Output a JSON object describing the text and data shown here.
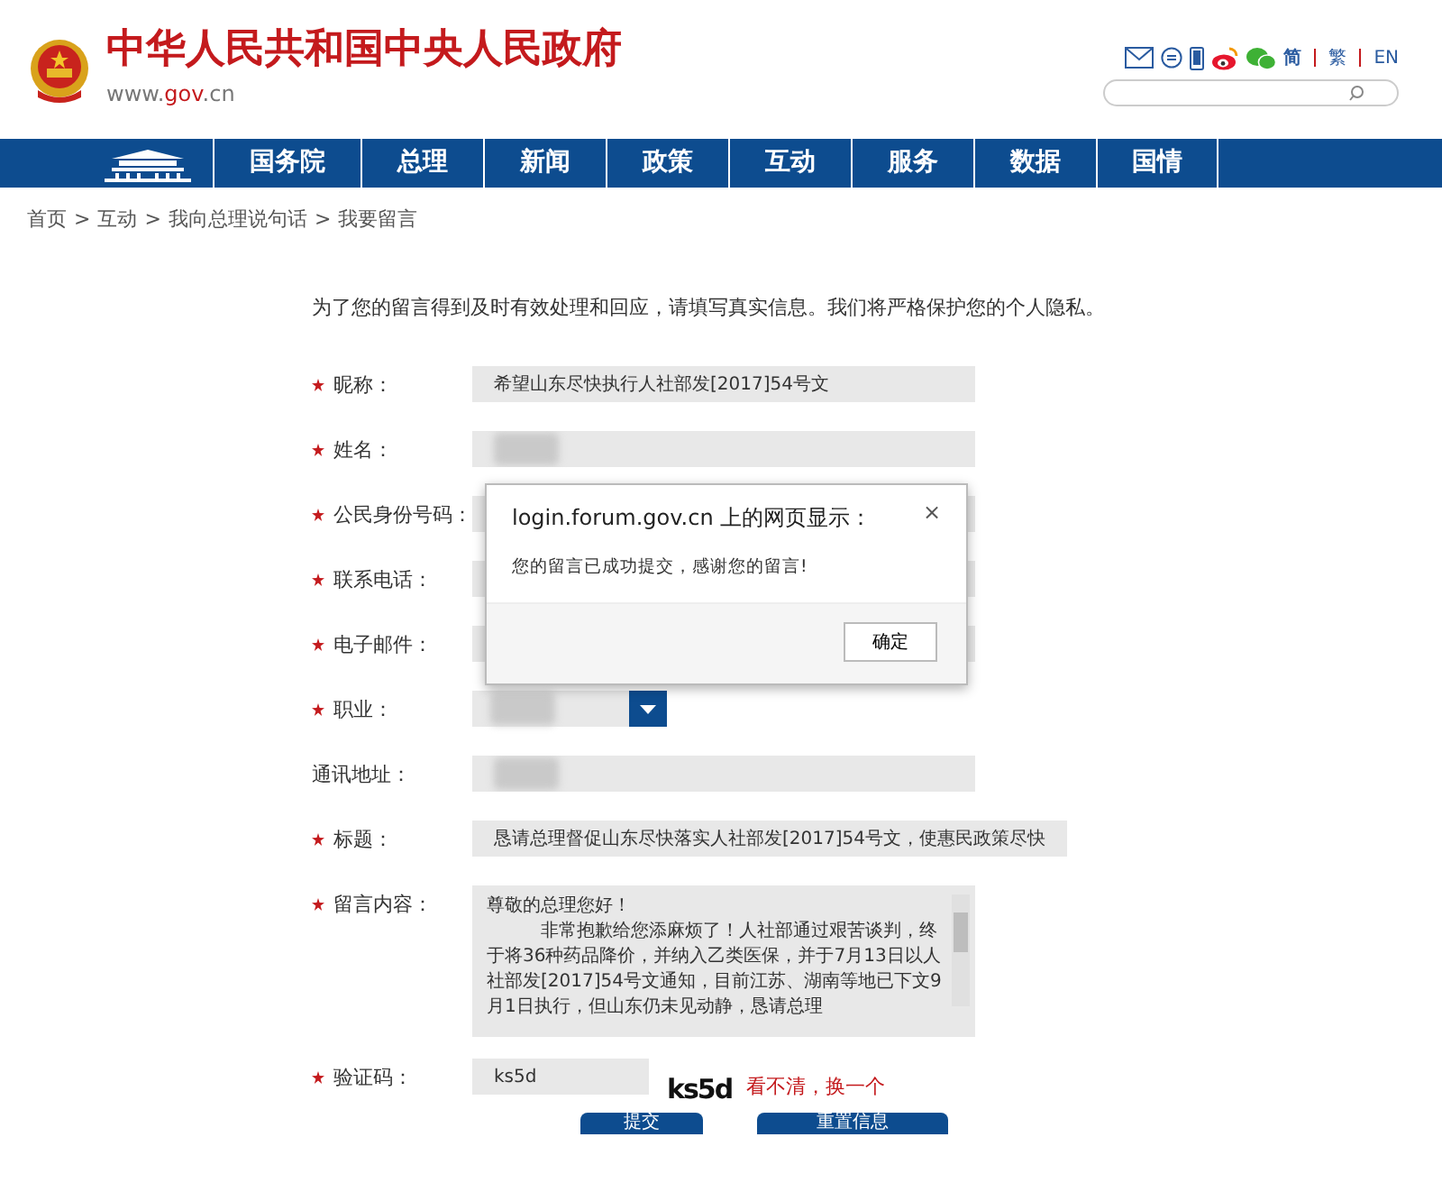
{
  "header": {
    "title": "中华人民共和国中央人民政府",
    "domain_parts": [
      "www.",
      "gov",
      ".cn"
    ],
    "lang_links": [
      {
        "label": "简",
        "selected": true
      },
      {
        "label": "繁",
        "selected": false
      },
      {
        "label": "EN",
        "selected": false
      }
    ]
  },
  "nav": {
    "items": [
      {
        "label": "国务院"
      },
      {
        "label": "总理"
      },
      {
        "label": "新闻"
      },
      {
        "label": "政策"
      },
      {
        "label": "互动"
      },
      {
        "label": "服务"
      },
      {
        "label": "数据"
      },
      {
        "label": "国情"
      }
    ]
  },
  "breadcrumb": [
    {
      "label": "首页"
    },
    {
      "label": "互动"
    },
    {
      "label": "我向总理说句话"
    },
    {
      "label": "我要留言"
    }
  ],
  "breadcrumb_separator": ">",
  "intro": "为了您的留言得到及时有效处理和回应，请填写真实信息。我们将严格保护您的个人隐私。",
  "fields": [
    {
      "kind": "text",
      "label": "昵称：",
      "required": true,
      "value": "希望山东尽快执行人社部发[2017]54号文",
      "redacted": false
    },
    {
      "kind": "text",
      "label": "姓名：",
      "required": true,
      "redacted": true
    },
    {
      "kind": "text",
      "label": "公民身份号码：",
      "required": true,
      "redacted": true
    },
    {
      "kind": "text",
      "label": "联系电话：",
      "required": true,
      "redacted": true
    },
    {
      "kind": "text",
      "label": "电子邮件：",
      "required": true,
      "redacted": true
    },
    {
      "kind": "select",
      "label": "职业：",
      "required": true,
      "redacted": true
    },
    {
      "kind": "text",
      "label": "通讯地址：",
      "required": false,
      "redacted": true
    },
    {
      "kind": "text",
      "label": "标题：",
      "required": true,
      "value": "恳请总理督促山东尽快落实人社部发[2017]54号文，使惠民政策尽快",
      "redacted": false
    },
    {
      "kind": "textarea",
      "label": "留言内容：",
      "required": true,
      "paragraphs": [
        "尊敬的总理您好！",
        "非常抱歉给您添麻烦了！人社部通过艰苦谈判，终于将36种药品降价，并纳入乙类医保，并于7月13日以人社部发[2017]54号文通知，目前江苏、湖南等地已下文9月1日执行，但山东仍未见动静，恳请总理"
      ]
    },
    {
      "kind": "captcha",
      "label": "验证码：",
      "required": true,
      "value": "ks5d",
      "captcha_text": "ks5d",
      "refresh": "看不清，换一个"
    }
  ],
  "buttons": [
    {
      "label": "提交"
    },
    {
      "label": "重置信息"
    }
  ],
  "dialog": {
    "title": "login.forum.gov.cn 上的网页显示：",
    "close": "×",
    "message": "您的留言已成功提交，感谢您的留言!",
    "button": "确定"
  }
}
